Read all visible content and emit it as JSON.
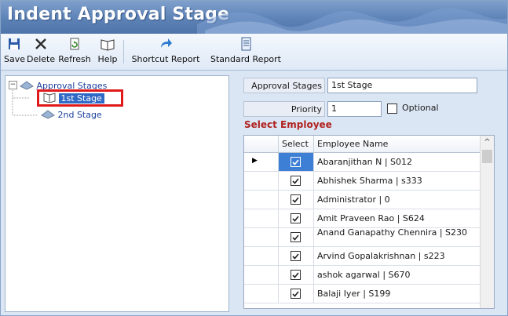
{
  "window": {
    "title": "Indent Approval Stage"
  },
  "toolbar": {
    "save": "Save",
    "delete": "Delete",
    "refresh": "Refresh",
    "help": "Help",
    "shortcut_report": "Shortcut Report",
    "standard_report": "Standard Report"
  },
  "tree": {
    "root": "Approval Stages",
    "items": [
      "1st Stage",
      "2nd Stage"
    ],
    "selected": "1st Stage"
  },
  "form": {
    "approval_stages_label": "Approval Stages",
    "approval_stages_value": "1st Stage",
    "priority_label": "Priority",
    "priority_value": "1",
    "optional_label": "Optional",
    "optional_checked": false
  },
  "grid": {
    "section_title": "Select Employee",
    "columns": [
      "Select",
      "Employee Name"
    ],
    "rows": [
      {
        "name": "Abaranjithan N | S012",
        "checked": true,
        "current": true
      },
      {
        "name": "Abhishek Sharma | s333",
        "checked": true
      },
      {
        "name": "Administrator | 0",
        "checked": true
      },
      {
        "name": "Amit Praveen Rao | S624",
        "checked": true
      },
      {
        "name": "Anand Ganapathy Chennira | S230",
        "checked": true
      },
      {
        "name": "Arvind Gopalakrishnan | s223",
        "checked": true
      },
      {
        "name": "ashok agarwal | S670",
        "checked": true
      },
      {
        "name": "Balaji Iyer | S199",
        "checked": true
      }
    ]
  },
  "colors": {
    "title_bar": "#5d82b6",
    "highlight_box": "#e01a1a",
    "section_title": "#b0221e",
    "selection": "#3d7fd4"
  },
  "icons": [
    "save-icon",
    "delete-icon",
    "refresh-icon",
    "help-icon",
    "shortcut-report-icon",
    "standard-report-icon",
    "tree-node-icon",
    "row-pointer-icon",
    "scroll-up-icon"
  ]
}
